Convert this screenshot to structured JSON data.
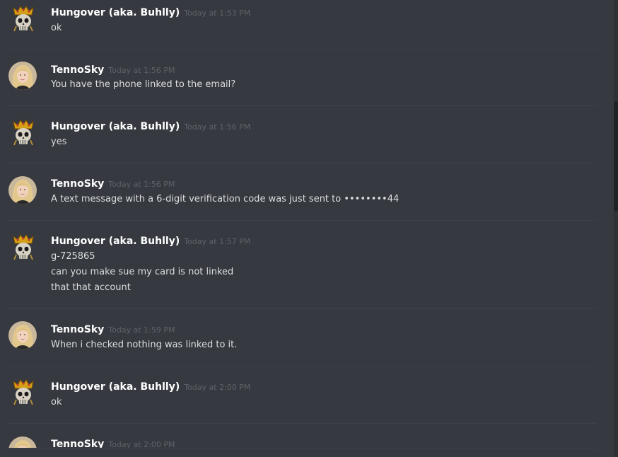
{
  "users": {
    "hungover": "Hungover (aka. Buhlly)",
    "tennosky": "TennoSky"
  },
  "messages": [
    {
      "author": "Hungover (aka. Buhlly)",
      "avatar_icon": "skull-crown-icon",
      "time": "Today at 1:53 PM",
      "lines": [
        "ok"
      ]
    },
    {
      "author": "TennoSky",
      "avatar_icon": "girl-portrait-icon",
      "time": "Today at 1:56 PM",
      "lines": [
        "You have the phone linked to the email?"
      ]
    },
    {
      "author": "Hungover (aka. Buhlly)",
      "avatar_icon": "skull-crown-icon",
      "time": "Today at 1:56 PM",
      "lines": [
        "yes"
      ]
    },
    {
      "author": "TennoSky",
      "avatar_icon": "girl-portrait-icon",
      "time": "Today at 1:56 PM",
      "lines": [
        "A text message with a 6-digit verification code was just sent to ••••••••44"
      ]
    },
    {
      "author": "Hungover (aka. Buhlly)",
      "avatar_icon": "skull-crown-icon",
      "time": "Today at 1:57 PM",
      "lines": [
        "g-725865",
        "can you make sue my card is not linked",
        "that that account"
      ]
    },
    {
      "author": "TennoSky",
      "avatar_icon": "girl-portrait-icon",
      "time": "Today at 1:59 PM",
      "lines": [
        "When i checked nothing was linked to it."
      ]
    },
    {
      "author": "Hungover (aka. Buhlly)",
      "avatar_icon": "skull-crown-icon",
      "time": "Today at 2:00 PM",
      "lines": [
        "ok"
      ]
    },
    {
      "author": "TennoSky",
      "avatar_icon": "girl-portrait-icon",
      "time": "Today at 2:00 PM",
      "lines": []
    }
  ],
  "colors": {
    "background": "#36393f",
    "username": "#ffffff",
    "message_text": "#dcddde",
    "timestamp": "#5f6268",
    "divider": "#3e4147"
  }
}
